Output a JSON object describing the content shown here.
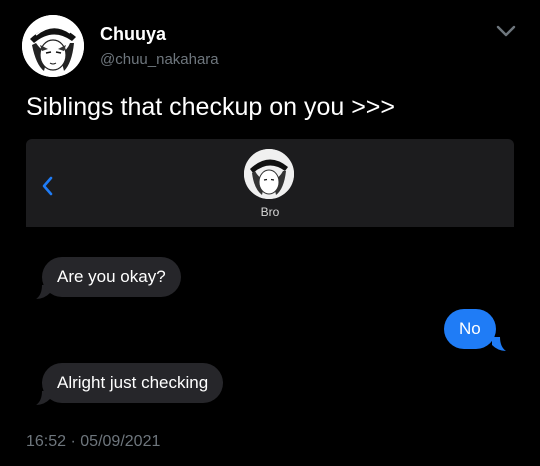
{
  "tweet": {
    "display_name": "Chuuya",
    "handle": "@chuu_nakahara",
    "text": "Siblings that checkup on you >>>",
    "time": "16:52",
    "separator": "·",
    "date": "05/09/2021"
  },
  "imessage": {
    "contact_name": "Bro",
    "messages": [
      {
        "direction": "received",
        "text": "Are you okay?"
      },
      {
        "direction": "sent",
        "text": "No"
      },
      {
        "direction": "received",
        "text": "Alright just checking"
      }
    ]
  },
  "colors": {
    "background": "#000000",
    "secondary_text": "#6e767d",
    "header_bar": "#1c1c1e",
    "received_bubble": "#26262a",
    "sent_bubble": "#1f7cf6",
    "link_blue": "#1f7cf6"
  },
  "icons": {
    "more": "chevron-down-icon",
    "back": "chevron-left-icon"
  }
}
